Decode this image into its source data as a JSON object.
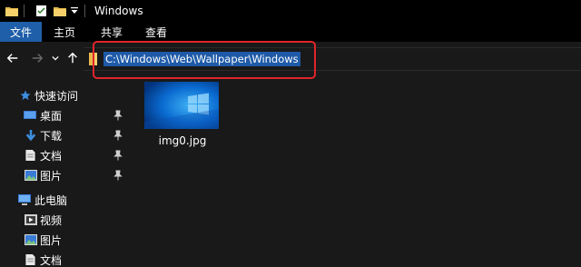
{
  "window": {
    "title": "Windows"
  },
  "ribbon": {
    "tabs": [
      "文件",
      "主页",
      "共享",
      "查看"
    ]
  },
  "address": {
    "path": "C:\\Windows\\Web\\Wallpaper\\Windows"
  },
  "sidebar": {
    "quick_access": "快速访问",
    "quick_items": [
      {
        "label": "桌面",
        "icon": "desktop-icon",
        "pinned": true
      },
      {
        "label": "下载",
        "icon": "download-icon",
        "pinned": true
      },
      {
        "label": "文档",
        "icon": "document-icon",
        "pinned": true
      },
      {
        "label": "图片",
        "icon": "pictures-icon",
        "pinned": true
      }
    ],
    "this_pc": "此电脑",
    "pc_items": [
      {
        "label": "视频",
        "icon": "videos-icon"
      },
      {
        "label": "图片",
        "icon": "pictures-icon"
      },
      {
        "label": "文档",
        "icon": "document-icon"
      }
    ]
  },
  "files": [
    {
      "name": "img0.jpg",
      "icon": "image-thumbnail"
    }
  ],
  "colors": {
    "titlebar": "#000000",
    "file_tab": "#1f5ea8",
    "background": "#191919",
    "selection": "#1e5aa8",
    "highlight_box": "#e0252a"
  }
}
